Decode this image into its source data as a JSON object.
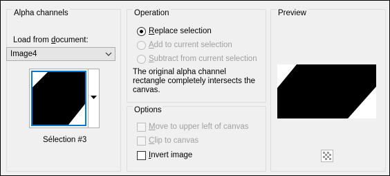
{
  "alpha_channels": {
    "group_title": "Alpha channels",
    "load_label_pre": "Load from ",
    "load_label_key": "d",
    "load_label_post": "ocument:",
    "document_value": "Image4",
    "selection_caption": "Sélection #3"
  },
  "operation": {
    "group_title": "Operation",
    "options": [
      {
        "key": "R",
        "rest": "eplace selection",
        "checked": true,
        "enabled": true
      },
      {
        "key": "A",
        "rest": "dd to current selection",
        "checked": false,
        "enabled": false
      },
      {
        "key": "S",
        "rest": "ubtract from current selection",
        "checked": false,
        "enabled": false
      }
    ],
    "message_line1": "The original alpha channel",
    "message_line2": "rectangle completely intersects the",
    "message_line3": "canvas."
  },
  "options": {
    "group_title": "Options",
    "checkboxes": [
      {
        "key": "M",
        "rest": "ove to upper left of canvas",
        "checked": false,
        "enabled": false
      },
      {
        "key": "C",
        "rest": "lip to canvas",
        "checked": false,
        "enabled": false
      },
      {
        "key": "I",
        "rest": "nvert image",
        "checked": false,
        "enabled": true
      }
    ]
  },
  "preview": {
    "group_title": "Preview"
  },
  "colors": {
    "accent_border": "#0078d7",
    "shape": "#000000",
    "background": "#f0f0f0"
  },
  "icons": {
    "dropdown": "chevron-down-icon",
    "thumb_dropdown": "triangle-down-icon",
    "transparency": "checkerboard-icon"
  }
}
